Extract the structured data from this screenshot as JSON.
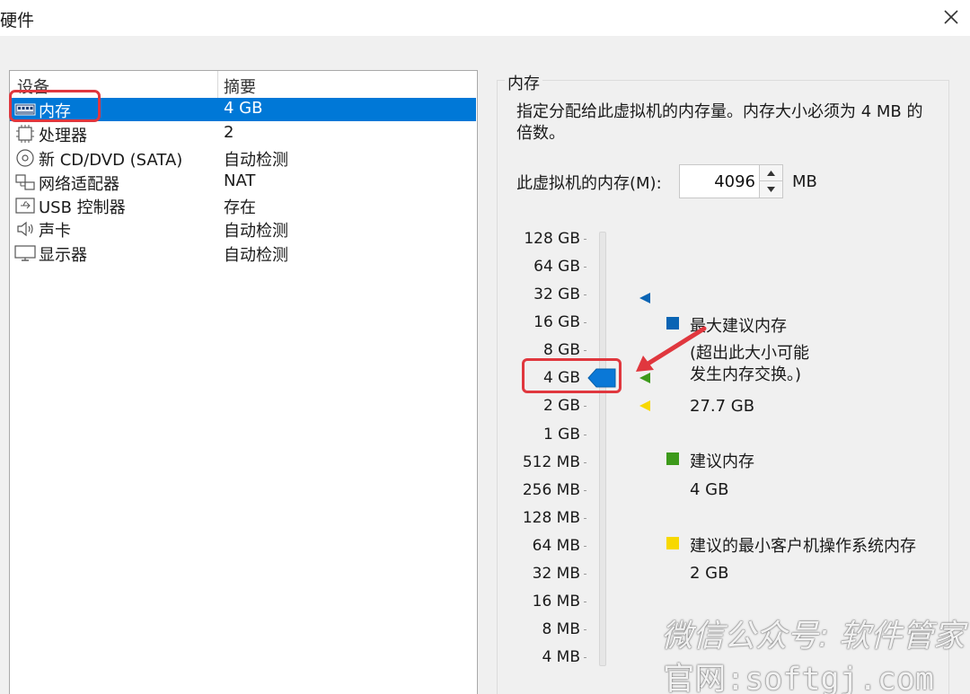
{
  "window": {
    "title": "硬件",
    "close_icon": "close-icon"
  },
  "device_list": {
    "header": {
      "device": "设备",
      "summary": "摘要"
    },
    "rows": [
      {
        "icon": "memory-icon",
        "name": "内存",
        "summary": "4 GB",
        "selected": true
      },
      {
        "icon": "processor-icon",
        "name": "处理器",
        "summary": "2",
        "selected": false
      },
      {
        "icon": "cd-dvd-icon",
        "name": "新 CD/DVD (SATA)",
        "summary": "自动检测",
        "selected": false
      },
      {
        "icon": "network-adapter-icon",
        "name": "网络适配器",
        "summary": "NAT",
        "selected": false
      },
      {
        "icon": "usb-icon",
        "name": "USB 控制器",
        "summary": "存在",
        "selected": false
      },
      {
        "icon": "sound-card-icon",
        "name": "声卡",
        "summary": "自动检测",
        "selected": false
      },
      {
        "icon": "display-icon",
        "name": "显示器",
        "summary": "自动检测",
        "selected": false
      }
    ]
  },
  "memory_panel": {
    "title": "内存",
    "description": "指定分配给此虚拟机的内存量。内存大小必须为 4 MB 的倍数。",
    "input_label": "此虚拟机的内存(M):",
    "input_value": "4096",
    "unit": "MB",
    "scale_labels": [
      "128 GB",
      "64 GB",
      "32 GB",
      "16 GB",
      "8 GB",
      "4 GB",
      "2 GB",
      "1 GB",
      "512 MB",
      "256 MB",
      "128 MB",
      "64 MB",
      "32 MB",
      "16 MB",
      "8 MB",
      "4 MB"
    ],
    "slider_value": "4 GB",
    "legend": {
      "max": {
        "label": "最大建议内存",
        "note_line1": "(超出此大小可能",
        "note_line2": "发生内存交换。)",
        "value": "27.7 GB",
        "color": "#0a64b4"
      },
      "recommended": {
        "label": "建议内存",
        "value": "4 GB",
        "color": "#3d9a1b"
      },
      "min": {
        "label": "建议的最小客户机操作系统内存",
        "value": "2 GB",
        "color": "#f7d800"
      }
    }
  },
  "watermark": {
    "line1": "微信公众号: 软件管家",
    "line2": "官网:softgj.com"
  },
  "colors": {
    "selection": "#0078d7",
    "highlight": "#e0373e"
  }
}
